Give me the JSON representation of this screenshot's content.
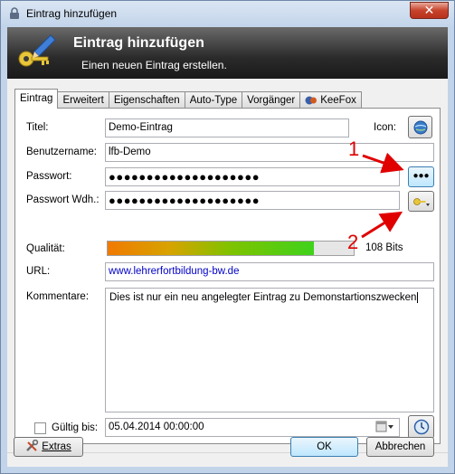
{
  "window": {
    "title": "Eintrag hinzufügen",
    "close_glyph": "✕"
  },
  "banner": {
    "title": "Eintrag hinzufügen",
    "subtitle": "Einen neuen Eintrag erstellen."
  },
  "tabs": [
    {
      "label": "Eintrag",
      "active": true
    },
    {
      "label": "Erweitert"
    },
    {
      "label": "Eigenschaften"
    },
    {
      "label": "Auto-Type"
    },
    {
      "label": "Vorgänger"
    },
    {
      "label": "KeeFox"
    }
  ],
  "form": {
    "title_label": "Titel:",
    "title_value": "Demo-Eintrag",
    "icon_label": "Icon:",
    "username_label": "Benutzername:",
    "username_value": "lfb-Demo",
    "password_label": "Passwort:",
    "password_value": "●●●●●●●●●●●●●●●●●●●●",
    "show_password_glyph": "●●●",
    "password_repeat_label": "Passwort Wdh.:",
    "password_repeat_value": "●●●●●●●●●●●●●●●●●●●●",
    "quality_label": "Qualität:",
    "quality_fraction": 0.84,
    "quality_text": "108 Bits",
    "url_label": "URL:",
    "url_value": "www.lehrerfortbildung-bw.de",
    "comments_label": "Kommentare:",
    "comments_value": "Dies ist nur ein neu angelegter Eintrag zu Demonstartionszwecken",
    "expires_label": "Gültig bis:",
    "expires_checked": false,
    "expires_value": "05.04.2014 00:00:00"
  },
  "annotations": {
    "one": "1",
    "two": "2",
    "color": "#e00000"
  },
  "footer": {
    "tools_label": "Extras",
    "ok_label": "OK",
    "cancel_label": "Abbrechen"
  }
}
